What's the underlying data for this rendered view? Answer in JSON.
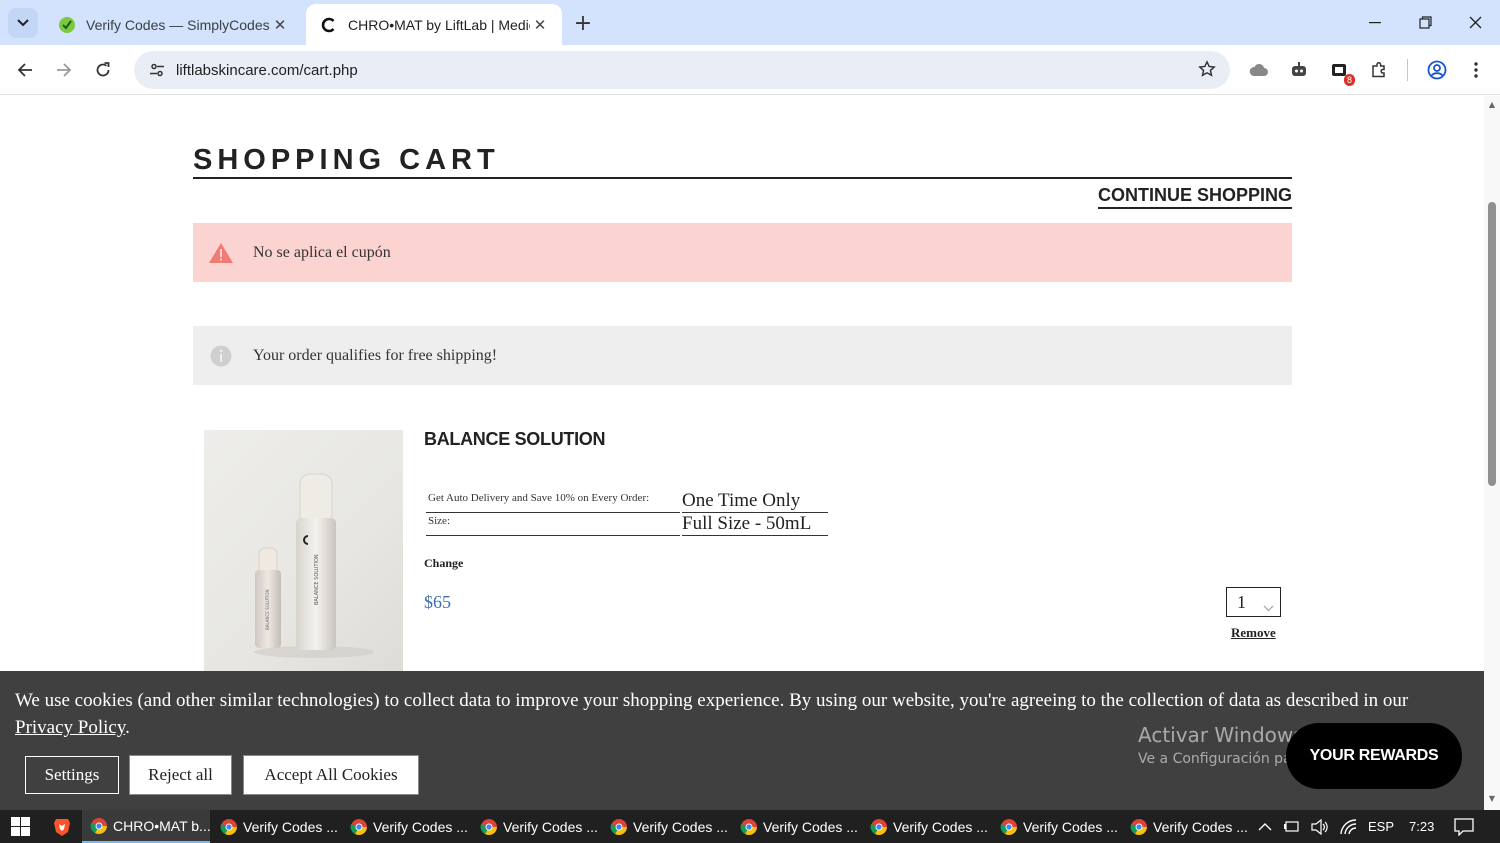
{
  "browser": {
    "tabs": [
      {
        "title": "Verify Codes — SimplyCodes",
        "active": false
      },
      {
        "title": "CHRO•MAT by LiftLab | Medical",
        "active": true
      }
    ],
    "url": "liftlabskincare.com/cart.php",
    "extension_badge": "8"
  },
  "page": {
    "title": "SHOPPING CART",
    "continue_label": "CONTINUE SHOPPING",
    "alerts": {
      "error": "No se aplica el cupón",
      "info": "Your order qualifies for free shipping!"
    },
    "item": {
      "name": "BALANCE SOLUTION",
      "options": [
        {
          "label": "Get Auto Delivery and Save 10% on Every Order:",
          "value": "One Time Only"
        },
        {
          "label": "Size:",
          "value": "Full Size - 50mL"
        }
      ],
      "change_label": "Change",
      "price": "$65",
      "quantity": "1",
      "remove_label": "Remove",
      "bottle_label": "BALANCE SOLUTION"
    },
    "cookie": {
      "text": "We use cookies (and other similar technologies) to collect data to improve your shopping experience. By using our website, you're agreeing to the collection of data as described in our ",
      "policy_link": "Privacy Policy",
      "after_link": ".",
      "settings_label": "Settings",
      "reject_label": "Reject all",
      "accept_label": "Accept All Cookies"
    },
    "windows_watermark": {
      "line1": "Activar Windows",
      "line2": "Ve a Configuración para activar Windows."
    },
    "rewards_label": "YOUR REWARDS"
  },
  "taskbar": {
    "items": [
      {
        "label": "CHRO•MAT b...",
        "active": true
      },
      {
        "label": "Verify Codes ...",
        "active": false
      },
      {
        "label": "Verify Codes ...",
        "active": false
      },
      {
        "label": "Verify Codes ...",
        "active": false
      },
      {
        "label": "Verify Codes ...",
        "active": false
      },
      {
        "label": "Verify Codes ...",
        "active": false
      },
      {
        "label": "Verify Codes ...",
        "active": false
      },
      {
        "label": "Verify Codes ...",
        "active": false
      },
      {
        "label": "Verify Codes ...",
        "active": false
      }
    ],
    "language": "ESP",
    "time": "7:23"
  },
  "colors": {
    "tabbar": "#d3e3fd",
    "error_bg": "#fbd3d0",
    "info_bg": "#eeeeee",
    "price": "#3d6fb5",
    "cookie_bg": "#404040"
  }
}
